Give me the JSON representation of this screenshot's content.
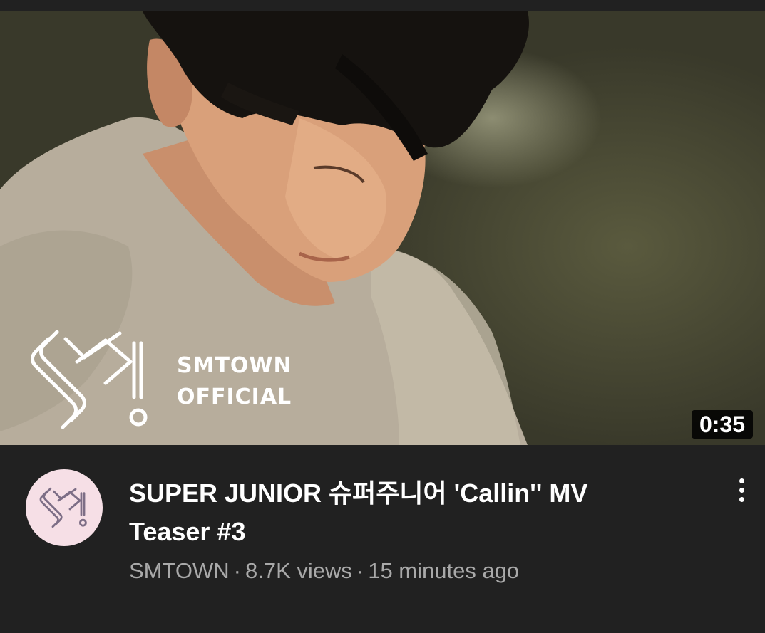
{
  "video": {
    "duration": "0:35",
    "thumbnail_logo_line1": "SMTOWN",
    "thumbnail_logo_line2": "OFFICIAL",
    "title": "SUPER JUNIOR 슈퍼주니어 'Callin'' MV Teaser #3",
    "channel": "SMTOWN",
    "views": "8.7K views",
    "age": "15 minutes ago",
    "separator": "·"
  },
  "icons": {
    "menu": "more-vert-icon",
    "avatar": "sm-logo-icon"
  },
  "colors": {
    "background": "#212121",
    "meta_text": "#a9a9a9",
    "avatar_bg": "#f6dfe6"
  }
}
